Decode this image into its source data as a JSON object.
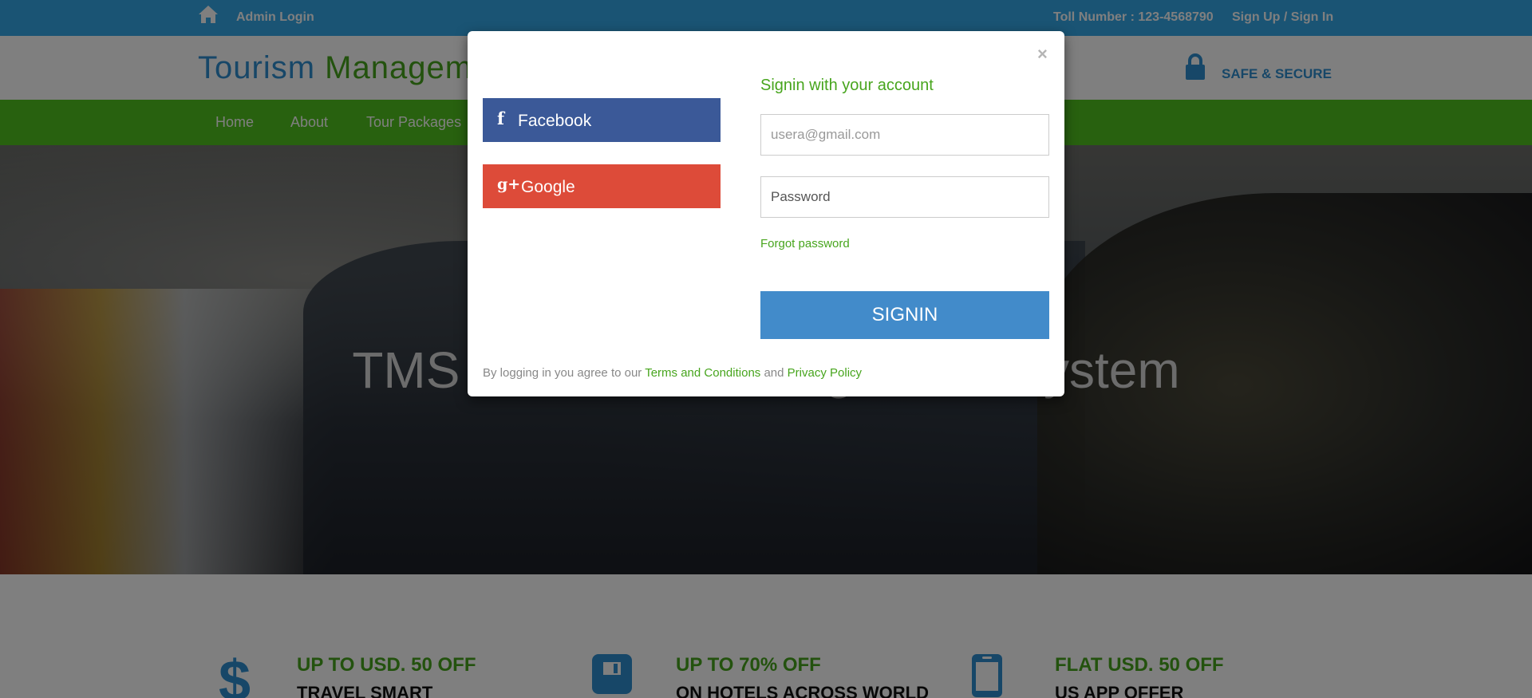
{
  "topbar": {
    "admin_login": "Admin Login",
    "toll_number": "Toll Number : 123-4568790",
    "signup_signin": "Sign Up / Sign In"
  },
  "header": {
    "logo_part1": "Tourism",
    "logo_part2": "Management",
    "secure_text": "SAFE & SECURE"
  },
  "nav": {
    "items": [
      "Home",
      "About",
      "Tour Packages"
    ]
  },
  "hero": {
    "title": "TMS - Tourism Management System"
  },
  "offers": [
    {
      "title": "UP TO USD. 50 OFF",
      "subtitle": "TRAVEL SMART",
      "icon": "dollar-icon"
    },
    {
      "title": "UP TO 70% OFF",
      "subtitle": "ON HOTELS ACROSS WORLD",
      "icon": "save-icon"
    },
    {
      "title": "FLAT USD. 50 OFF",
      "subtitle": "US APP OFFER",
      "icon": "mobile-icon"
    }
  ],
  "modal": {
    "close": "×",
    "facebook_label": "Facebook",
    "google_label": "Google",
    "heading": "Signin with your account",
    "email_placeholder": "usera@gmail.com",
    "password_placeholder": "Password",
    "forgot_password": "Forgot password",
    "signin_button": "SIGNIN",
    "terms_prefix": "By logging in you agree to our",
    "terms_link": "Terms and Conditions",
    "terms_and": "and",
    "privacy_link": "Privacy Policy"
  },
  "colors": {
    "topbar": "#34a8e9",
    "nav": "#51c21e",
    "accent_green": "#47a51d",
    "accent_blue": "#2f8fd0",
    "facebook": "#3b5998",
    "google": "#dd4b39",
    "signin": "#428bca"
  }
}
